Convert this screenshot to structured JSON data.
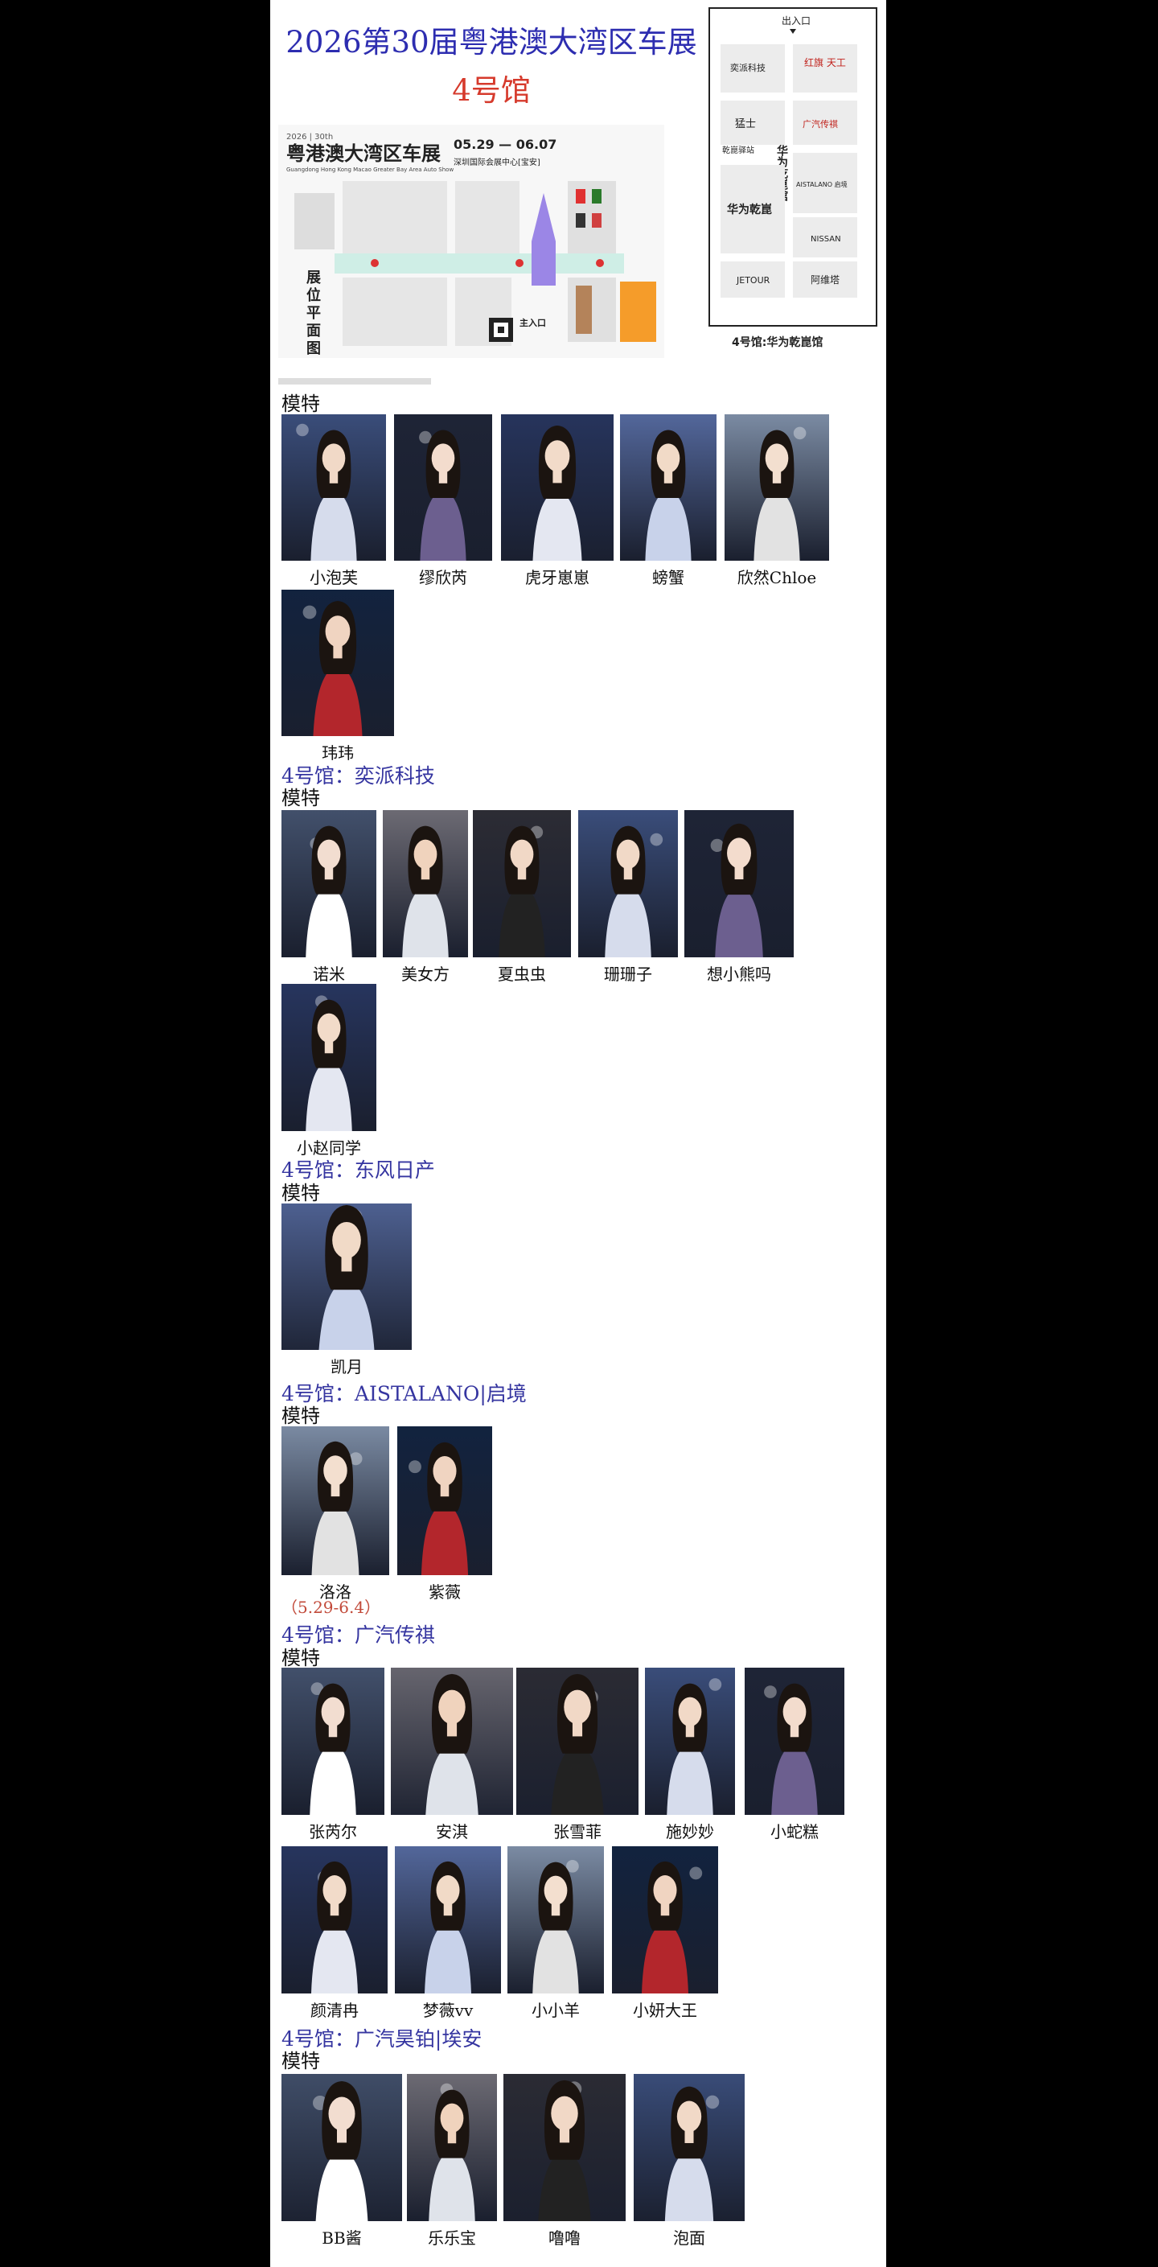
{
  "header": {
    "title_line1": "2026第30届粤港澳大湾区车展",
    "title_line2": "4号馆"
  },
  "event_map": {
    "show_name": "粤港澳大湾区车展",
    "show_edition": "2026 | 30th",
    "show_subtitle": "Guangdong Hong Kong Macao Greater Bay Area Auto Show",
    "dates": "05.29 — 06.07",
    "venue": "深圳国际会展中心[宝安]",
    "vertical_label": "展位平面图",
    "main_entrance": "主入口"
  },
  "hall_map": {
    "entrance": "出入口",
    "booths": [
      "奕派科技",
      "红旗 天工",
      "猛士",
      "广汽传祺",
      "乾崑驿站",
      "华为乾崑馆",
      "华为乾崑",
      "AISTALANO 启境",
      "NISSAN",
      "JETOUR",
      "阿维塔"
    ],
    "caption": "4号馆:华为乾崑馆"
  },
  "sections": [
    {
      "heading": "",
      "label": "模特",
      "models": [
        "小泡芙",
        "缪欣芮",
        "虎牙崽崽",
        "螃蟹",
        "欣然Chloe",
        "玮玮"
      ]
    },
    {
      "heading": "4号馆：奕派科技",
      "label": "模特",
      "models": [
        "诺米",
        "美女方",
        "夏虫虫",
        "珊珊子",
        "想小熊吗",
        "小赵同学"
      ]
    },
    {
      "heading": "4号馆：东风日产",
      "label": "模特",
      "models": [
        "凯月"
      ]
    },
    {
      "heading": "4号馆：AISTALANO|启境",
      "label": "模特",
      "models": [
        "洛洛",
        "紫薇"
      ],
      "note": "（5.29-6.4）"
    },
    {
      "heading": "4号馆：广汽传祺",
      "label": "模特",
      "models": [
        "张芮尔",
        "安淇",
        "张雪菲",
        "施妙妙",
        "小蛇糕",
        "颜清冉",
        "梦薇vv",
        "小小羊",
        "小妍大王"
      ]
    },
    {
      "heading": "4号馆：广汽昊铂|埃安",
      "label": "模特",
      "models": [
        "BB酱",
        "乐乐宝",
        "噜噜",
        "泡面"
      ]
    }
  ]
}
